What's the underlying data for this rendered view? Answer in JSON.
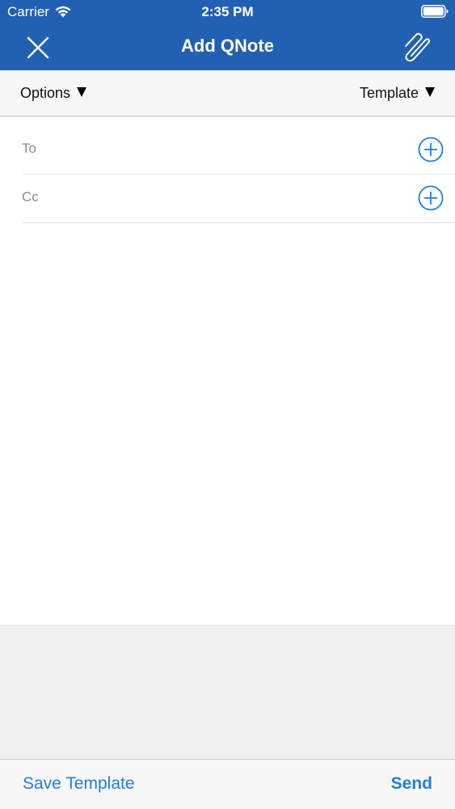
{
  "status_bar": {
    "carrier": "Carrier",
    "time": "2:35 PM",
    "wifi_icon": "wifi-icon",
    "battery_icon": "battery-icon"
  },
  "nav": {
    "title": "Add QNote",
    "close_icon": "close-icon",
    "attach_icon": "paperclip-icon"
  },
  "options_bar": {
    "options_label": "Options",
    "template_label": "Template"
  },
  "recipients": {
    "to_label": "To",
    "to_value": "",
    "cc_label": "Cc",
    "cc_value": ""
  },
  "body": {
    "value": ""
  },
  "toolbar": {
    "save_template_label": "Save Template",
    "send_label": "Send"
  },
  "colors": {
    "header_blue": "#2260b4",
    "accent_blue": "#1f7fde",
    "options_bg": "#f7f7f7",
    "gray_area": "#efeff2"
  }
}
